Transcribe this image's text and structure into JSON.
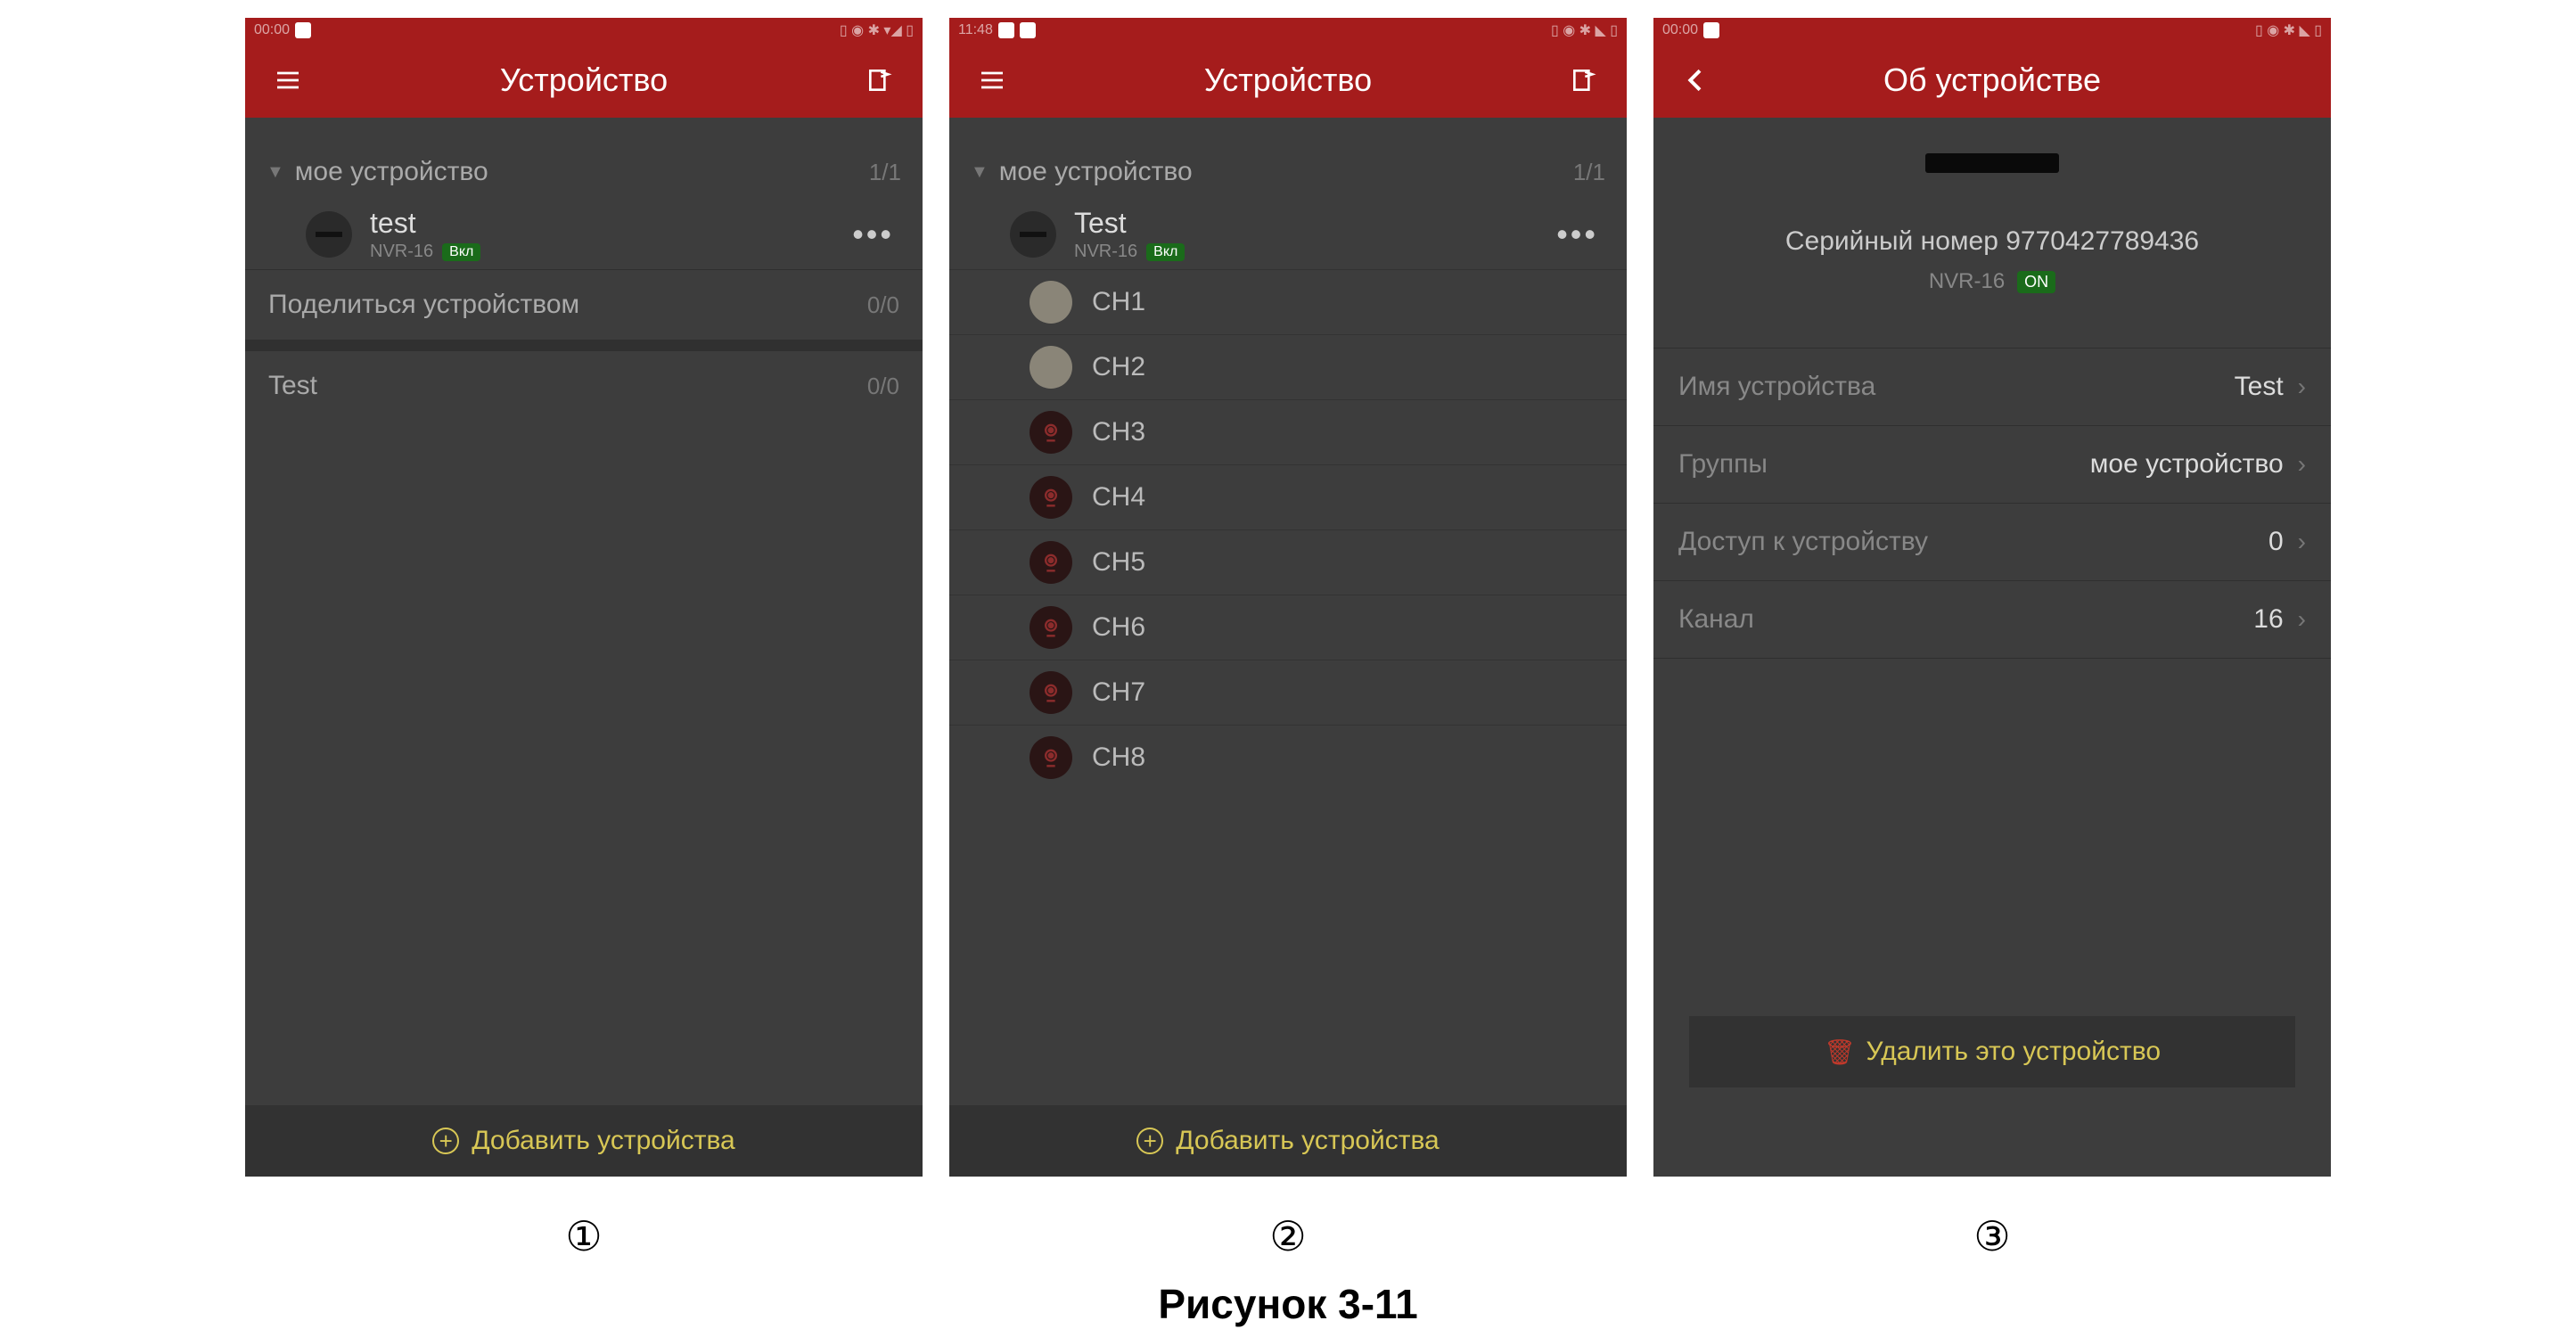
{
  "screen1": {
    "status_time": "00:00",
    "header_title": "Устройство",
    "group_name": "мое устройство",
    "group_count": "1/1",
    "device_name": "test",
    "device_model": "NVR-16",
    "device_status": "Вкл",
    "share_label": "Поделиться устройством",
    "share_count": "0/0",
    "test_label": "Test",
    "test_count": "0/0",
    "add_label": "Добавить устройства"
  },
  "screen2": {
    "status_time": "11:48",
    "header_title": "Устройство",
    "group_name": "мое устройство",
    "group_count": "1/1",
    "device_name": "Test",
    "device_model": "NVR-16",
    "device_status": "Вкл",
    "channels": [
      {
        "name": "CH1",
        "live": true
      },
      {
        "name": "CH2",
        "live": true
      },
      {
        "name": "CH3",
        "live": false
      },
      {
        "name": "CH4",
        "live": false
      },
      {
        "name": "CH5",
        "live": false
      },
      {
        "name": "CH6",
        "live": false
      },
      {
        "name": "CH7",
        "live": false
      },
      {
        "name": "CH8",
        "live": false
      }
    ],
    "add_label": "Добавить устройства"
  },
  "screen3": {
    "status_time": "00:00",
    "header_title": "Об устройстве",
    "serial_label": "Серийный номер 9770427789436",
    "device_model": "NVR-16",
    "device_status": "ON",
    "row_name_label": "Имя устройства",
    "row_name_value": "Test",
    "row_group_label": "Группы",
    "row_group_value": "мое устройство",
    "row_access_label": "Доступ к устройству",
    "row_access_value": "0",
    "row_channel_label": "Канал",
    "row_channel_value": "16",
    "delete_label": "Удалить это устройство"
  },
  "labels": {
    "n1": "①",
    "n2": "②",
    "n3": "③"
  },
  "caption": "Рисунок 3-11"
}
